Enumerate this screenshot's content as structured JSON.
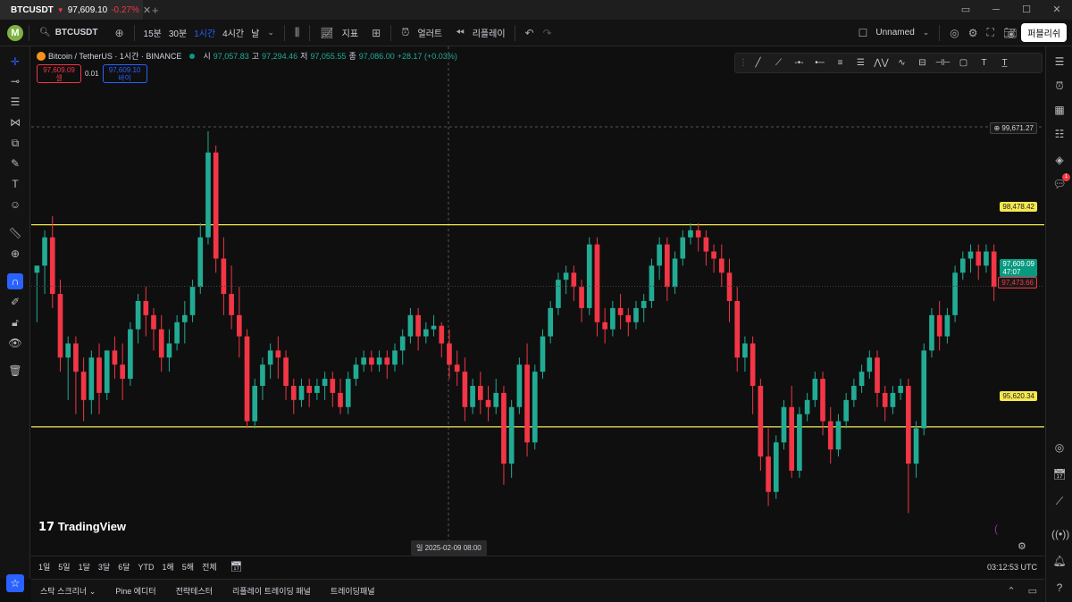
{
  "window": {
    "tab_symbol": "BTCUSDT",
    "tab_price": "97,609.10",
    "tab_change": "-0.27%",
    "new_tab": "+",
    "controls": [
      "▭",
      "─",
      "☐",
      "✕"
    ]
  },
  "toolbar": {
    "avatar_letter": "M",
    "symbol": "BTCUSDT",
    "intervals": [
      "15분",
      "30분",
      "1시간",
      "4시간",
      "날"
    ],
    "active_interval": "1시간",
    "indicators_label": "지표",
    "alerts_label": "얼러트",
    "replay_label": "리플레이",
    "layout_name": "Unnamed",
    "publish_label": "퍼블리쉬"
  },
  "legend": {
    "title": "Bitcoin / TetherUS · 1시간 · BINANCE",
    "open_key": "시",
    "open": "97,057.83",
    "high_key": "고",
    "high": "97,294.46",
    "low_key": "저",
    "low": "97,055.55",
    "close_key": "종",
    "close": "97,086.00",
    "change": "+28.17 (+0.03%)"
  },
  "trade": {
    "sell_price": "97,609.09",
    "sell_label": "셀",
    "spread": "0.01",
    "buy_price": "97,609.10",
    "buy_label": "바이"
  },
  "price_labels": {
    "crosshair": "99,671.27",
    "upper_line": "98,478.42",
    "last_price": "97,609.09",
    "countdown": "47:07",
    "prev_close": "97,473.66",
    "lower_line": "95,620.34"
  },
  "crosshair_date": "일 2025-02-09   08:00",
  "watermark": "TradingView",
  "ranges": [
    "1일",
    "5일",
    "1달",
    "3달",
    "6달",
    "YTD",
    "1해",
    "5해",
    "전체"
  ],
  "clock": "03:12:53 UTC",
  "panels": [
    "스탁 스크리너",
    "Pine 에디터",
    "전략테스터",
    "리플레이 트레이딩 패널",
    "트레이딩패널"
  ],
  "notification_count": "1",
  "colors": {
    "up": "#22ab94",
    "down": "#f23645",
    "hline": "#f5e850",
    "accent": "#2962ff"
  },
  "chart_data": {
    "type": "candlestick",
    "ylim": [
      93800,
      101000
    ],
    "hlines": [
      98478.42,
      95620.34
    ],
    "candles": [
      {
        "o": 97800,
        "h": 97900,
        "c": 97900,
        "l": 97100
      },
      {
        "o": 97900,
        "h": 98400,
        "c": 98300,
        "l": 97500
      },
      {
        "o": 98300,
        "h": 98600,
        "c": 97500,
        "l": 97300
      },
      {
        "o": 97500,
        "h": 97700,
        "c": 96600,
        "l": 96400
      },
      {
        "o": 96600,
        "h": 96900,
        "c": 96800,
        "l": 96000
      },
      {
        "o": 96800,
        "h": 96900,
        "c": 96400,
        "l": 95800
      },
      {
        "o": 96400,
        "h": 96600,
        "c": 96000,
        "l": 95700
      },
      {
        "o": 96000,
        "h": 96700,
        "c": 96600,
        "l": 95800
      },
      {
        "o": 96600,
        "h": 96800,
        "c": 96100,
        "l": 95800
      },
      {
        "o": 96100,
        "h": 96700,
        "c": 96700,
        "l": 96000
      },
      {
        "o": 96700,
        "h": 96900,
        "c": 96500,
        "l": 96300
      },
      {
        "o": 96500,
        "h": 96800,
        "c": 96300,
        "l": 96000
      },
      {
        "o": 96300,
        "h": 97100,
        "c": 97000,
        "l": 96200
      },
      {
        "o": 97000,
        "h": 97500,
        "c": 97400,
        "l": 96800
      },
      {
        "o": 97400,
        "h": 97600,
        "c": 97200,
        "l": 96900
      },
      {
        "o": 97200,
        "h": 97300,
        "c": 97000,
        "l": 96700
      },
      {
        "o": 97000,
        "h": 97200,
        "c": 96600,
        "l": 96400
      },
      {
        "o": 96600,
        "h": 97000,
        "c": 96800,
        "l": 96400
      },
      {
        "o": 96800,
        "h": 97200,
        "c": 97100,
        "l": 96700
      },
      {
        "o": 97100,
        "h": 97400,
        "c": 97200,
        "l": 96800
      },
      {
        "o": 97200,
        "h": 97700,
        "c": 97600,
        "l": 97100
      },
      {
        "o": 97600,
        "h": 98500,
        "c": 98300,
        "l": 97500
      },
      {
        "o": 98300,
        "h": 99800,
        "c": 99500,
        "l": 98200
      },
      {
        "o": 99500,
        "h": 99600,
        "c": 98000,
        "l": 97800
      },
      {
        "o": 98000,
        "h": 98300,
        "c": 97500,
        "l": 97200
      },
      {
        "o": 97500,
        "h": 97900,
        "c": 97200,
        "l": 97000
      },
      {
        "o": 97200,
        "h": 97600,
        "c": 96900,
        "l": 96600
      },
      {
        "o": 96900,
        "h": 97000,
        "c": 95700,
        "l": 95600
      },
      {
        "o": 95700,
        "h": 96300,
        "c": 96200,
        "l": 95600
      },
      {
        "o": 96200,
        "h": 96600,
        "c": 96500,
        "l": 96000
      },
      {
        "o": 96500,
        "h": 96800,
        "c": 96700,
        "l": 96300
      },
      {
        "o": 96700,
        "h": 96900,
        "c": 96600,
        "l": 96300
      },
      {
        "o": 96600,
        "h": 96700,
        "c": 96200,
        "l": 96000
      },
      {
        "o": 96200,
        "h": 96300,
        "c": 96000,
        "l": 95800
      },
      {
        "o": 96000,
        "h": 96300,
        "c": 96200,
        "l": 95900
      },
      {
        "o": 96200,
        "h": 96300,
        "c": 96100,
        "l": 95900
      },
      {
        "o": 96100,
        "h": 96300,
        "c": 96200,
        "l": 96000
      },
      {
        "o": 96200,
        "h": 96400,
        "c": 96300,
        "l": 96000
      },
      {
        "o": 96300,
        "h": 96400,
        "c": 96100,
        "l": 95900
      },
      {
        "o": 96100,
        "h": 96300,
        "c": 95900,
        "l": 95800
      },
      {
        "o": 95900,
        "h": 96400,
        "c": 96300,
        "l": 95800
      },
      {
        "o": 96300,
        "h": 96600,
        "c": 96500,
        "l": 96200
      },
      {
        "o": 96500,
        "h": 96700,
        "c": 96600,
        "l": 96400
      },
      {
        "o": 96600,
        "h": 96700,
        "c": 96500,
        "l": 96400
      },
      {
        "o": 96500,
        "h": 96700,
        "c": 96600,
        "l": 96400
      },
      {
        "o": 96600,
        "h": 96700,
        "c": 96500,
        "l": 96300
      },
      {
        "o": 96500,
        "h": 96800,
        "c": 96700,
        "l": 96400
      },
      {
        "o": 96700,
        "h": 97000,
        "c": 96900,
        "l": 96500
      },
      {
        "o": 96900,
        "h": 97300,
        "c": 97200,
        "l": 96800
      },
      {
        "o": 97200,
        "h": 97300,
        "c": 96900,
        "l": 96700
      },
      {
        "o": 96900,
        "h": 97100,
        "c": 97000,
        "l": 96800
      },
      {
        "o": 97000,
        "h": 97200,
        "c": 97050,
        "l": 96900
      },
      {
        "o": 97050,
        "h": 97100,
        "c": 96800,
        "l": 96600
      },
      {
        "o": 96800,
        "h": 97000,
        "c": 96500,
        "l": 96300
      },
      {
        "o": 96500,
        "h": 96700,
        "c": 96400,
        "l": 96200
      },
      {
        "o": 96400,
        "h": 96600,
        "c": 95900,
        "l": 95700
      },
      {
        "o": 95900,
        "h": 96300,
        "c": 96200,
        "l": 95800
      },
      {
        "o": 96200,
        "h": 96400,
        "c": 96000,
        "l": 95800
      },
      {
        "o": 96000,
        "h": 96200,
        "c": 95900,
        "l": 95700
      },
      {
        "o": 95900,
        "h": 96300,
        "c": 96100,
        "l": 95800
      },
      {
        "o": 96100,
        "h": 96200,
        "c": 95100,
        "l": 94800
      },
      {
        "o": 95100,
        "h": 96000,
        "c": 95900,
        "l": 94900
      },
      {
        "o": 95900,
        "h": 96600,
        "c": 96500,
        "l": 95800
      },
      {
        "o": 96500,
        "h": 96800,
        "c": 95400,
        "l": 95200
      },
      {
        "o": 95400,
        "h": 96500,
        "c": 96400,
        "l": 95300
      },
      {
        "o": 96400,
        "h": 97000,
        "c": 96900,
        "l": 96300
      },
      {
        "o": 96900,
        "h": 97400,
        "c": 97300,
        "l": 96800
      },
      {
        "o": 97300,
        "h": 97800,
        "c": 97700,
        "l": 97200
      },
      {
        "o": 97700,
        "h": 97900,
        "c": 97800,
        "l": 97500
      },
      {
        "o": 97800,
        "h": 97900,
        "c": 97600,
        "l": 97400
      },
      {
        "o": 97600,
        "h": 97700,
        "c": 97300,
        "l": 97100
      },
      {
        "o": 97300,
        "h": 98300,
        "c": 98200,
        "l": 97200
      },
      {
        "o": 98200,
        "h": 98300,
        "c": 97100,
        "l": 96900
      },
      {
        "o": 97100,
        "h": 97300,
        "c": 97000,
        "l": 96800
      },
      {
        "o": 97000,
        "h": 97400,
        "c": 97300,
        "l": 96900
      },
      {
        "o": 97300,
        "h": 97500,
        "c": 97200,
        "l": 97000
      },
      {
        "o": 97200,
        "h": 97300,
        "c": 97100,
        "l": 96900
      },
      {
        "o": 97100,
        "h": 97400,
        "c": 97300,
        "l": 97000
      },
      {
        "o": 97300,
        "h": 97500,
        "c": 97400,
        "l": 97100
      },
      {
        "o": 97400,
        "h": 98000,
        "c": 97900,
        "l": 97300
      },
      {
        "o": 97900,
        "h": 98300,
        "c": 98200,
        "l": 97700
      },
      {
        "o": 98200,
        "h": 98300,
        "c": 97600,
        "l": 97400
      },
      {
        "o": 97600,
        "h": 98100,
        "c": 98000,
        "l": 97500
      },
      {
        "o": 98000,
        "h": 98400,
        "c": 98300,
        "l": 97900
      },
      {
        "o": 98300,
        "h": 98500,
        "c": 98400,
        "l": 98200
      },
      {
        "o": 98400,
        "h": 98500,
        "c": 98300,
        "l": 98100
      },
      {
        "o": 98300,
        "h": 98400,
        "c": 98100,
        "l": 97900
      },
      {
        "o": 98100,
        "h": 98200,
        "c": 98000,
        "l": 97800
      },
      {
        "o": 98000,
        "h": 98200,
        "c": 97800,
        "l": 97600
      },
      {
        "o": 97800,
        "h": 98000,
        "c": 97400,
        "l": 97100
      },
      {
        "o": 97400,
        "h": 97600,
        "c": 96600,
        "l": 96400
      },
      {
        "o": 96600,
        "h": 96900,
        "c": 96800,
        "l": 96400
      },
      {
        "o": 96800,
        "h": 96900,
        "c": 96200,
        "l": 95800
      },
      {
        "o": 96200,
        "h": 96300,
        "c": 95200,
        "l": 95000
      },
      {
        "o": 95200,
        "h": 95600,
        "c": 94700,
        "l": 94500
      },
      {
        "o": 94700,
        "h": 95500,
        "c": 95400,
        "l": 94600
      },
      {
        "o": 95400,
        "h": 96000,
        "c": 95900,
        "l": 95300
      },
      {
        "o": 95900,
        "h": 96200,
        "c": 95000,
        "l": 94900
      },
      {
        "o": 95000,
        "h": 95900,
        "c": 95800,
        "l": 94900
      },
      {
        "o": 95800,
        "h": 96100,
        "c": 96000,
        "l": 95700
      },
      {
        "o": 96000,
        "h": 96400,
        "c": 96300,
        "l": 95900
      },
      {
        "o": 96300,
        "h": 96400,
        "c": 95700,
        "l": 95500
      },
      {
        "o": 95700,
        "h": 95900,
        "c": 95300,
        "l": 95100
      },
      {
        "o": 95300,
        "h": 95800,
        "c": 95700,
        "l": 95200
      },
      {
        "o": 95700,
        "h": 96100,
        "c": 96000,
        "l": 95600
      },
      {
        "o": 96000,
        "h": 96300,
        "c": 96200,
        "l": 95900
      },
      {
        "o": 96200,
        "h": 96500,
        "c": 96400,
        "l": 96100
      },
      {
        "o": 96400,
        "h": 96700,
        "c": 96600,
        "l": 96300
      },
      {
        "o": 96600,
        "h": 96700,
        "c": 96100,
        "l": 95900
      },
      {
        "o": 96100,
        "h": 96200,
        "c": 95900,
        "l": 95700
      },
      {
        "o": 95900,
        "h": 96200,
        "c": 96100,
        "l": 95800
      },
      {
        "o": 96100,
        "h": 96300,
        "c": 96200,
        "l": 96000
      },
      {
        "o": 96200,
        "h": 96300,
        "c": 95100,
        "l": 94400
      },
      {
        "o": 95100,
        "h": 95700,
        "c": 95600,
        "l": 94900
      },
      {
        "o": 95600,
        "h": 96800,
        "c": 96700,
        "l": 95500
      },
      {
        "o": 96700,
        "h": 97300,
        "c": 97200,
        "l": 96600
      },
      {
        "o": 97200,
        "h": 97400,
        "c": 96900,
        "l": 96700
      },
      {
        "o": 96900,
        "h": 97300,
        "c": 97200,
        "l": 96800
      },
      {
        "o": 97200,
        "h": 97900,
        "c": 97800,
        "l": 97100
      },
      {
        "o": 97800,
        "h": 98100,
        "c": 98000,
        "l": 97700
      },
      {
        "o": 98000,
        "h": 98200,
        "c": 98100,
        "l": 97800
      },
      {
        "o": 98100,
        "h": 98200,
        "c": 97900,
        "l": 97700
      },
      {
        "o": 97900,
        "h": 98200,
        "c": 98100,
        "l": 97800
      },
      {
        "o": 98100,
        "h": 98200,
        "c": 97600,
        "l": 97400
      }
    ]
  }
}
